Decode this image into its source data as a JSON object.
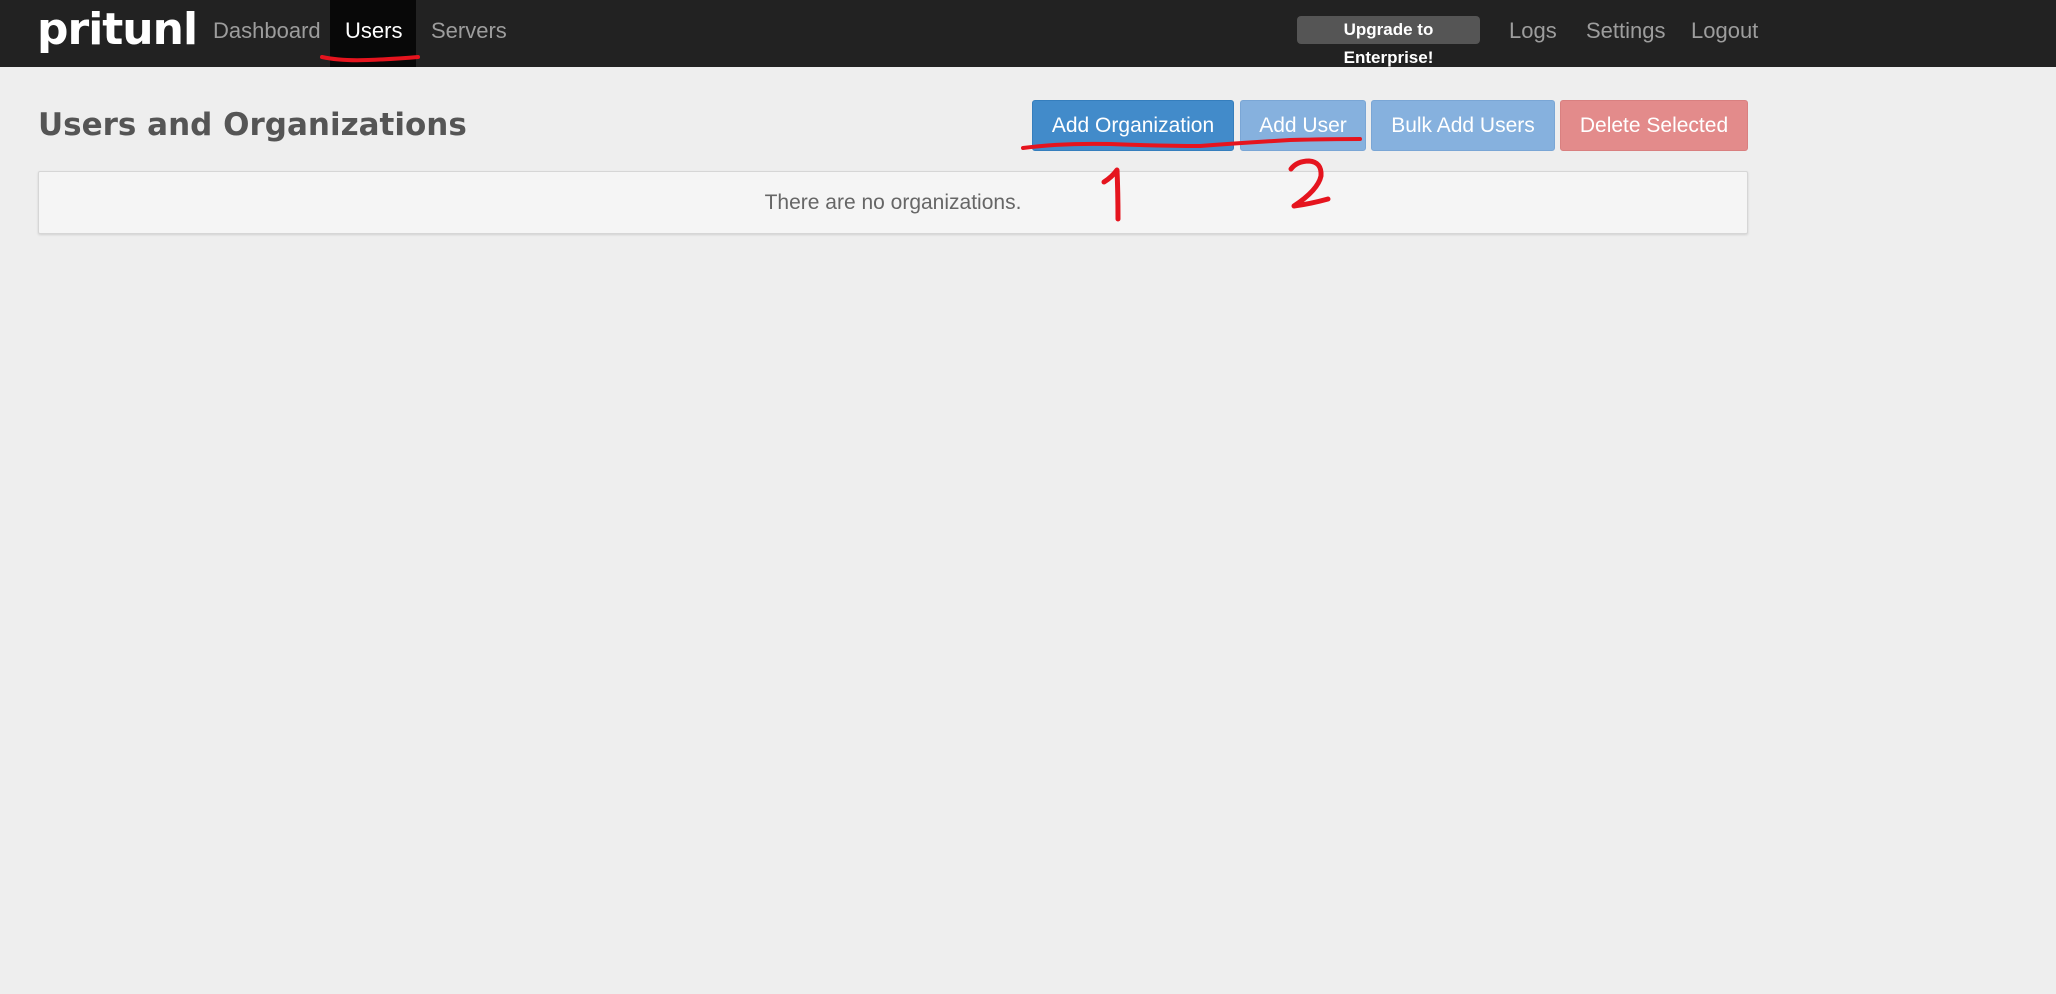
{
  "app": {
    "brand": "pritunl"
  },
  "nav": {
    "dashboard": "Dashboard",
    "users": "Users",
    "servers": "Servers",
    "upgrade": "Upgrade to Enterprise!",
    "logs": "Logs",
    "settings": "Settings",
    "logout": "Logout",
    "active_tab": "Users"
  },
  "page": {
    "title": "Users and Organizations",
    "buttons": {
      "add_organization": "Add Organization",
      "add_user": "Add User",
      "bulk_add_users": "Bulk Add Users",
      "delete_selected": "Delete Selected"
    },
    "empty_message": "There are no organizations."
  },
  "annotations": {
    "step_1": "1",
    "step_2": "2",
    "color": "#e5141e"
  },
  "colors": {
    "navbar_bg": "#222222",
    "page_bg": "#eeeeee",
    "primary": "#428bca",
    "primary_disabled": "#86b1de",
    "danger_disabled": "#e38b8b"
  }
}
